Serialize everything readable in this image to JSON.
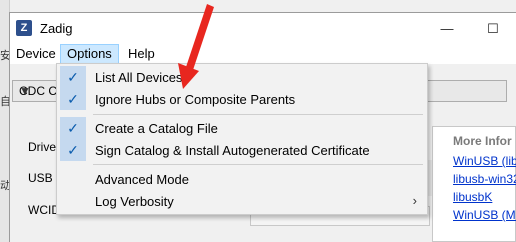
{
  "window": {
    "title": "Zadig",
    "icon_letter": "Z",
    "controls": {
      "minimize": "—",
      "maximize": "☐",
      "close": "✕"
    }
  },
  "menubar": {
    "items": [
      {
        "label": "Device"
      },
      {
        "label": "Options",
        "active": true
      },
      {
        "label": "Help"
      }
    ]
  },
  "options_menu": {
    "items": [
      {
        "label": "List All Devices",
        "checked": true
      },
      {
        "label": "Ignore Hubs or Composite Parents",
        "checked": true
      },
      {
        "label": "Create a Catalog File",
        "checked": true
      },
      {
        "label": "Sign Catalog & Install Autogenerated Certificate",
        "checked": true
      },
      {
        "label": "Advanced Mode",
        "checked": false
      },
      {
        "label": "Log Verbosity",
        "checked": false,
        "submenu": "›"
      }
    ],
    "check_glyph": "✓"
  },
  "background": {
    "device_combo_value": "CDC C",
    "labels": {
      "driver": "Driver",
      "usb_id": "USB ID",
      "wcid": "WCID"
    },
    "info_panel": {
      "title": "More Infor",
      "links": [
        "WinUSB (libus",
        "libusb-win32",
        "libusbK",
        "WinUSB (Micr"
      ]
    },
    "desktop_chars": [
      "安",
      "自",
      "动"
    ]
  },
  "annotation": {
    "arrow_color": "#e8271f"
  }
}
